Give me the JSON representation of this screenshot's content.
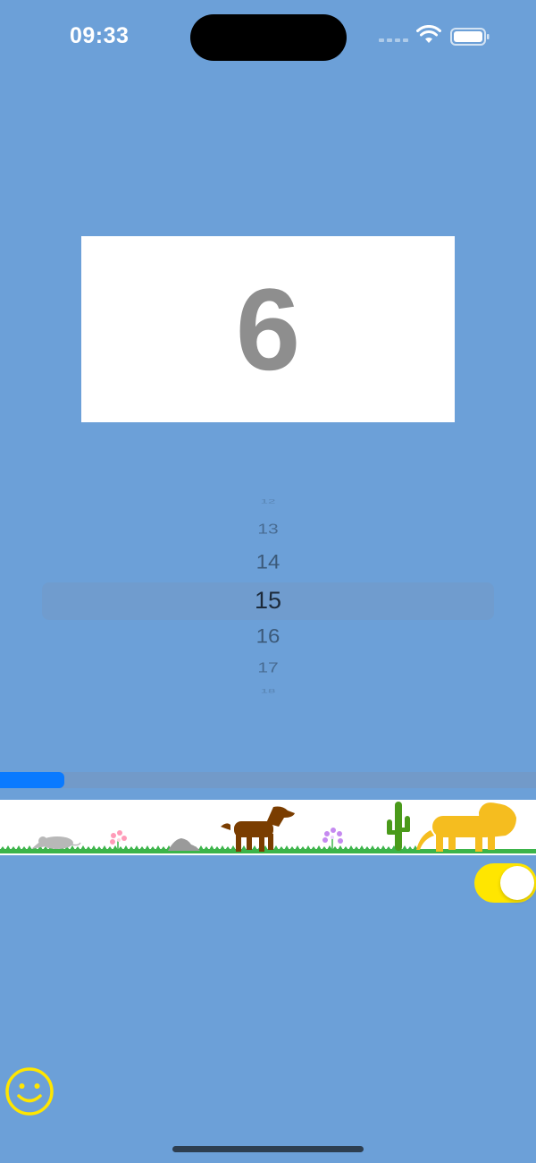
{
  "status_bar": {
    "time": "09:33",
    "icons": [
      "cellular-signal-icon",
      "wifi-icon",
      "battery-icon"
    ]
  },
  "counter": {
    "value": "6"
  },
  "picker": {
    "rows": [
      "12",
      "13",
      "14",
      "15",
      "16",
      "17",
      "18"
    ],
    "selected": "15"
  },
  "progress": {
    "value_percent": 12,
    "fill_color": "#0a7aff"
  },
  "scene": {
    "items": [
      "rat",
      "pink-flower",
      "rock",
      "dog",
      "purple-flower",
      "cactus",
      "lion"
    ],
    "colors": {
      "dog": "#7a3d00",
      "lion": "#f5bd1f",
      "cactus": "#4a9a1a",
      "grass": "#3cb44a",
      "rat": "#b8b8b8",
      "rock": "#9a9a9a"
    }
  },
  "toggle": {
    "state": "on",
    "color": "#ffe600"
  },
  "smiley": {
    "icon": "smiley-face-icon",
    "color": "#ffe600"
  },
  "colors": {
    "background": "#6ca0d8"
  }
}
